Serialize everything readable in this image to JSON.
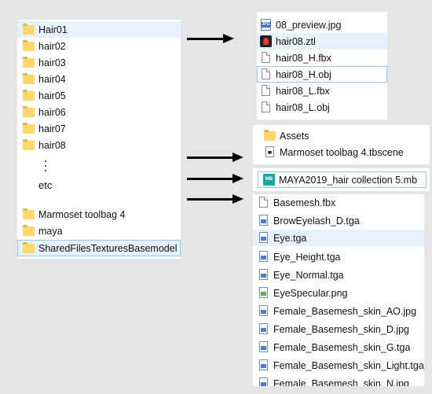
{
  "left_panel": {
    "folders": [
      {
        "label": "Hair01"
      },
      {
        "label": "hair02"
      },
      {
        "label": "hair03"
      },
      {
        "label": "hair04"
      },
      {
        "label": "hair05"
      },
      {
        "label": "hair06"
      },
      {
        "label": "hair07"
      },
      {
        "label": "hair08"
      }
    ],
    "etc_label": "etc",
    "bottom_folders": [
      {
        "label": "Marmoset toolbag 4"
      },
      {
        "label": "maya"
      },
      {
        "label": "SharedFilesTexturesBasemodel"
      }
    ]
  },
  "hair08_panel": {
    "files": [
      {
        "label": "08_preview.jpg",
        "icon": "jpg-file-icon"
      },
      {
        "label": "hair08.ztl",
        "icon": "zbrush-file-icon"
      },
      {
        "label": "hair08_H.fbx",
        "icon": "file-icon"
      },
      {
        "label": "hair08_H.obj",
        "icon": "file-icon"
      },
      {
        "label": "hair08_L.fbx",
        "icon": "file-icon"
      },
      {
        "label": "hair08_L.obj",
        "icon": "file-icon"
      }
    ]
  },
  "marmoset_panel": {
    "items": [
      {
        "label": "Assets",
        "icon": "folder-icon"
      },
      {
        "label": "Marmoset toolbag 4.tbscene",
        "icon": "scene-file-icon"
      }
    ]
  },
  "maya_panel": {
    "items": [
      {
        "label": "MAYA2019_hair collection 5.mb",
        "icon": "maya-file-icon"
      }
    ]
  },
  "textures_panel": {
    "files": [
      {
        "label": "Basemesh.fbx"
      },
      {
        "label": "BrowEyelash_D.tga"
      },
      {
        "label": "Eye.tga"
      },
      {
        "label": "Eye_Height.tga"
      },
      {
        "label": "Eye_Normal.tga"
      },
      {
        "label": "EyeSpecular.png"
      },
      {
        "label": "Female_Basemesh_skin_AO.jpg"
      },
      {
        "label": "Female_Basemesh_skin_D.jpg"
      },
      {
        "label": "Female_Basemesh_skin_G.tga"
      },
      {
        "label": "Female_Basemesh_skin_Light.tga"
      },
      {
        "label": "Female_Basemesh_skin_N.jpg"
      }
    ]
  },
  "colors": {
    "background": "#e5e5e5",
    "selection": "#e5f1fb",
    "folder": "#ffd86b"
  }
}
